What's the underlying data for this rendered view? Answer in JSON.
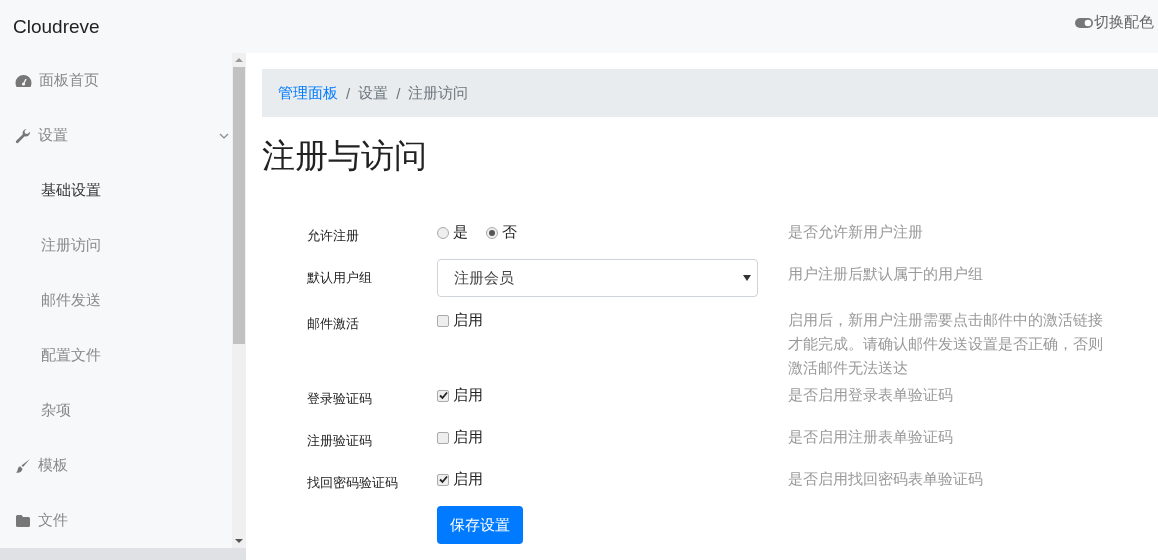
{
  "header": {
    "brand": "Cloudreve",
    "theme_toggle": "切换配色"
  },
  "sidebar": {
    "items": [
      {
        "label": "面板首页"
      },
      {
        "label": "设置",
        "expanded": true,
        "children": [
          {
            "label": "基础设置",
            "selected": true
          },
          {
            "label": "注册访问",
            "selected": false
          },
          {
            "label": "邮件发送",
            "selected": false
          },
          {
            "label": "配置文件",
            "selected": false
          },
          {
            "label": "杂项",
            "selected": false
          }
        ]
      },
      {
        "label": "模板"
      },
      {
        "label": "文件"
      }
    ]
  },
  "breadcrumb": [
    {
      "kind": "link",
      "label": "管理面板"
    },
    {
      "kind": "separator",
      "label": "/"
    },
    {
      "kind": "text",
      "label": "设置"
    },
    {
      "kind": "separator",
      "label": "/"
    },
    {
      "kind": "text",
      "label": "注册访问"
    }
  ],
  "page_title": "注册与访问",
  "form": {
    "fields": [
      {
        "kind": "radio",
        "label": "允许注册",
        "options": [
          {
            "label": "是",
            "selected": false
          },
          {
            "label": "否",
            "selected": true
          }
        ],
        "help": "是否允许新用户注册"
      },
      {
        "kind": "select",
        "label": "默认用户组",
        "value": "注册会员",
        "help": "用户注册后默认属于的用户组"
      },
      {
        "kind": "checkbox",
        "label": "邮件激活",
        "option": "启用",
        "checked": false,
        "help": "启用后，新用户注册需要点击邮件中的激活链接才能完成。请确认邮件发送设置是否正确，否则激活邮件无法送达"
      },
      {
        "kind": "checkbox",
        "label": "登录验证码",
        "option": "启用",
        "checked": true,
        "help": "是否启用登录表单验证码"
      },
      {
        "kind": "checkbox",
        "label": "注册验证码",
        "option": "启用",
        "checked": false,
        "help": "是否启用注册表单验证码"
      },
      {
        "kind": "checkbox",
        "label": "找回密码验证码",
        "option": "启用",
        "checked": true,
        "help": "是否启用找回密码表单验证码"
      }
    ],
    "submit": "保存设置"
  }
}
